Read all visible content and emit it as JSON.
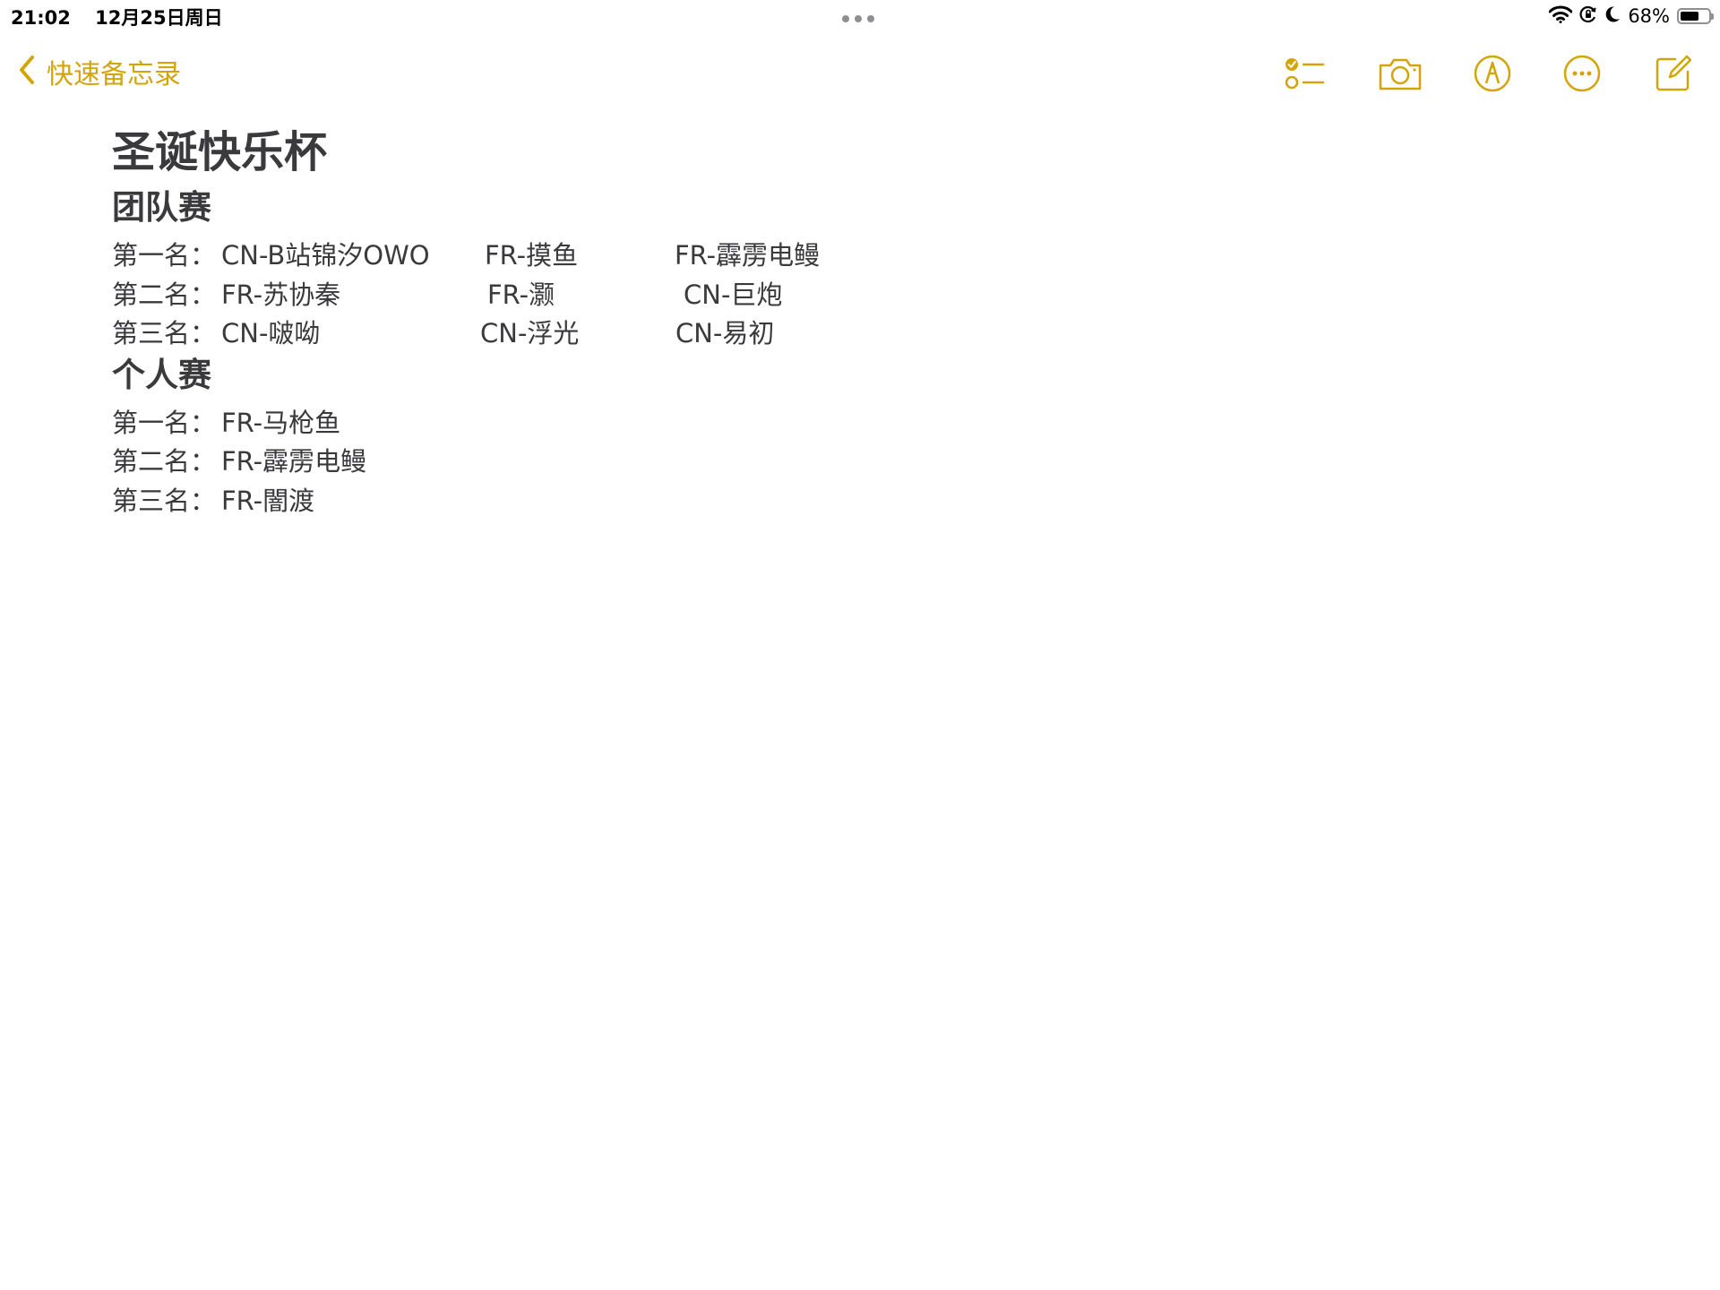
{
  "status_bar": {
    "time": "21:02",
    "date": "12月25日周日",
    "battery_percent": "68%",
    "battery_level": 0.68,
    "icons": [
      "wifi-icon",
      "orientation-lock-icon",
      "moon-icon",
      "battery-icon"
    ]
  },
  "toolbar": {
    "back_label": "快速备忘录",
    "accent_color": "#d4a40b",
    "buttons": [
      "checklist-icon",
      "camera-icon",
      "markup-icon",
      "more-icon",
      "compose-icon"
    ]
  },
  "note": {
    "title": "圣诞快乐杯",
    "sections": [
      {
        "heading": "团队赛",
        "rows": [
          {
            "rank": "第一名：",
            "entries": [
              "CN-B站锦汐OWO",
              "FR-摸鱼",
              "FR-霹雳电鳗"
            ]
          },
          {
            "rank": "第二名：",
            "entries": [
              "FR-苏协秦",
              "FR-灏",
              "CN-巨炮"
            ]
          },
          {
            "rank": "第三名：",
            "entries": [
              "CN-啵呦",
              "CN-浮光",
              "CN-易初"
            ]
          }
        ]
      },
      {
        "heading": "个人赛",
        "rows": [
          {
            "rank": "第一名：",
            "entries": [
              "FR-马枪鱼"
            ]
          },
          {
            "rank": "第二名：",
            "entries": [
              "FR-霹雳电鳗"
            ]
          },
          {
            "rank": "第三名：",
            "entries": [
              "FR-闇渡"
            ]
          }
        ]
      }
    ]
  }
}
